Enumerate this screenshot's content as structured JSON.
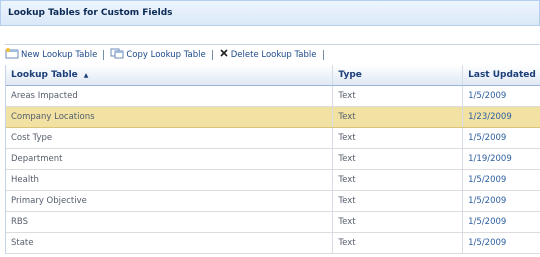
{
  "section": {
    "title": "Lookup Tables for Custom Fields"
  },
  "toolbar": {
    "new_label": "New Lookup Table",
    "copy_label": "Copy Lookup Table",
    "delete_label": "Delete Lookup Table"
  },
  "grid": {
    "columns": [
      "Lookup Table",
      "Type",
      "Last Updated"
    ],
    "sort_indicator": "▲",
    "rows": [
      {
        "name": "Areas Impacted",
        "type": "Text",
        "updated": "1/5/2009"
      },
      {
        "name": "Company Locations",
        "type": "Text",
        "updated": "1/23/2009"
      },
      {
        "name": "Cost Type",
        "type": "Text",
        "updated": "1/5/2009"
      },
      {
        "name": "Department",
        "type": "Text",
        "updated": "1/19/2009"
      },
      {
        "name": "Health",
        "type": "Text",
        "updated": "1/5/2009"
      },
      {
        "name": "Primary Objective",
        "type": "Text",
        "updated": "1/5/2009"
      },
      {
        "name": "RBS",
        "type": "Text",
        "updated": "1/5/2009"
      },
      {
        "name": "State",
        "type": "Text",
        "updated": "1/5/2009"
      }
    ],
    "selected_row": 1
  },
  "colors": {
    "selected_row": "#f1e2a4",
    "header_text": "#1c3f78"
  },
  "icons": [
    "new-table-icon",
    "copy-table-icon",
    "delete-x-icon"
  ]
}
